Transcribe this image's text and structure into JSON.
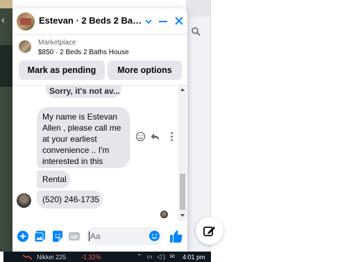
{
  "colors": {
    "accent": "#0084ff",
    "bubble": "#e4e6eb",
    "text_secondary": "#65676b"
  },
  "chat": {
    "title": "Estevan · 2 Beds 2 Baths H...",
    "header_icons": [
      "chevron-down-icon",
      "minimize-icon",
      "close-icon"
    ]
  },
  "listing": {
    "source": "Marketplace",
    "price_title": "$850 · 2 Beds 2 Baths House"
  },
  "actions": {
    "mark_pending": "Mark as pending",
    "more_options": "More options"
  },
  "messages": [
    {
      "text": "Sorry, it's not av..."
    },
    {
      "text": "My name is Estevan Allen , please call me at your earliest convenience .. I'm interested in  this"
    },
    {
      "text": "Rental"
    },
    {
      "text": "(520) 246-1735"
    }
  ],
  "composer": {
    "placeholder": "Aa",
    "icons": [
      "plus-icon",
      "photo-icon",
      "sticker-icon",
      "gif-icon",
      "emoji-icon",
      "like-icon"
    ]
  },
  "taskbar": {
    "item_label": "Nikkei 225",
    "item_change": "-1.32%",
    "time": "4:01 pm"
  }
}
